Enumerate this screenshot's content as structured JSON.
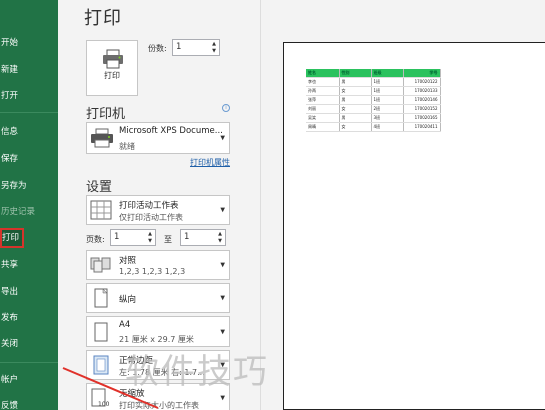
{
  "sidebar": {
    "items": [
      {
        "label": "开始",
        "top": 0
      },
      {
        "label": "新建"
      },
      {
        "label": "打开"
      },
      {
        "label": "信息"
      },
      {
        "label": "保存"
      },
      {
        "label": "另存为"
      },
      {
        "label": "历史记录"
      },
      {
        "label": "打印"
      },
      {
        "label": "共享"
      },
      {
        "label": "导出"
      },
      {
        "label": "发布"
      },
      {
        "label": "关闭"
      },
      {
        "label": "帐户"
      },
      {
        "label": "反馈"
      }
    ]
  },
  "main": {
    "title": "打印",
    "print_button": "打印",
    "copies_label": "份数:",
    "copies_value": "1",
    "printer_section": "打印机",
    "printer_name": "Microsoft XPS Docume...",
    "printer_status": "就绪",
    "printer_properties": "打印机属性",
    "settings_section": "设置",
    "scope_title": "打印活动工作表",
    "scope_sub": "仅打印活动工作表",
    "pages_label": "页数:",
    "pages_from": "1",
    "pages_to_label": "至",
    "pages_to": "1",
    "collate_title": "对照",
    "collate_sub": "1,2,3    1,2,3    1,2,3",
    "orientation": "纵向",
    "paper_title": "A4",
    "paper_sub": "21 厘米 x 29.7 厘米",
    "margins_title": "正常边距",
    "margins_sub": "左: 1.78 厘米    右: 1.7...",
    "scaling_title": "无缩放",
    "scaling_sub": "打印实际大小的工作表"
  },
  "preview": {
    "header": [
      "姓名",
      "性别",
      "班级",
      "学号"
    ],
    "rows": [
      [
        "李也",
        "男",
        "1班",
        "170020122"
      ],
      [
        "孙两",
        "女",
        "1班",
        "170020133"
      ],
      [
        "张萍",
        "男",
        "1班",
        "170020146"
      ],
      [
        "刘丽",
        "女",
        "2班",
        "170020152"
      ],
      [
        "吴笑",
        "男",
        "3班",
        "170020165"
      ],
      [
        "周晴",
        "女",
        "4班",
        "170020411"
      ]
    ]
  },
  "watermark": "软件技巧",
  "colors": {
    "accent": "#217346",
    "header_green": "#2bc25e",
    "active_border": "#d6342b"
  }
}
